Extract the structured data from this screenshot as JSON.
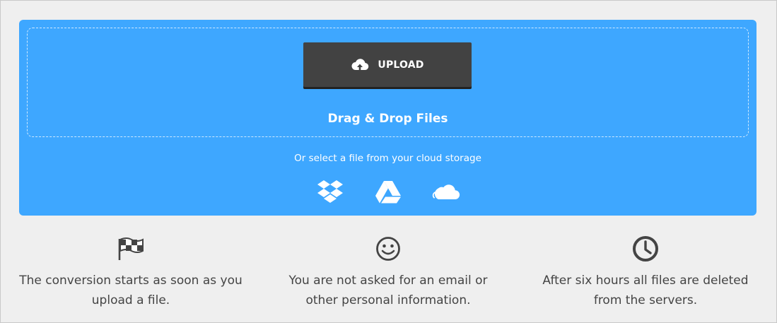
{
  "upload": {
    "button_label": "UPLOAD",
    "drop_label": "Drag & Drop Files",
    "cloud_text": "Or select a file from your cloud storage",
    "cloud_services": [
      {
        "icon": "dropbox-icon"
      },
      {
        "icon": "google-drive-icon"
      },
      {
        "icon": "onedrive-icon"
      }
    ],
    "accent_color": "#3ea7ff",
    "button_color": "#424242"
  },
  "features": [
    {
      "icon": "checkered-flag-icon",
      "line1": "The conversion starts as soon as you",
      "line2": "upload a file."
    },
    {
      "icon": "smiley-icon",
      "line1": "You are not asked for an email or",
      "line2": "other personal information."
    },
    {
      "icon": "clock-icon",
      "line1": "After six hours all files are deleted",
      "line2": "from the servers."
    }
  ]
}
